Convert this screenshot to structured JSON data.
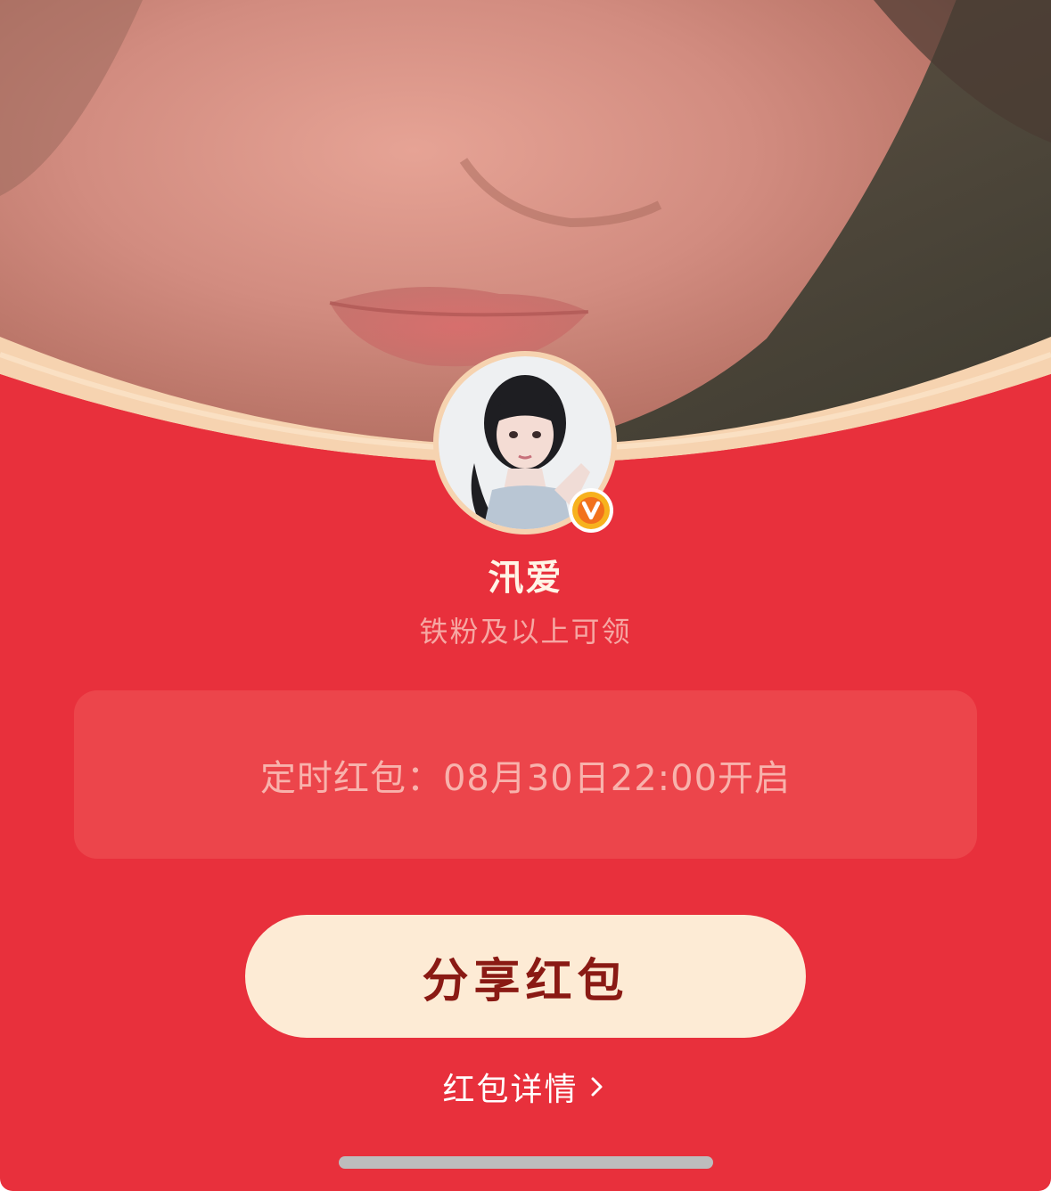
{
  "profile": {
    "username": "汛爱",
    "eligibility": "铁粉及以上可领",
    "verified_icon": "verified-v-badge-icon"
  },
  "timer": {
    "text": "定时红包：08月30日22:00开启"
  },
  "actions": {
    "share_label": "分享红包",
    "details_label": "红包详情",
    "details_icon": "chevron-right-icon"
  },
  "colors": {
    "card_red": "#e8303c",
    "timer_box": "#ec454b",
    "button_cream": "#fdebd5",
    "button_text": "#8a1a14",
    "badge_gold": "#f7b21e",
    "badge_orange": "#f2711c"
  }
}
